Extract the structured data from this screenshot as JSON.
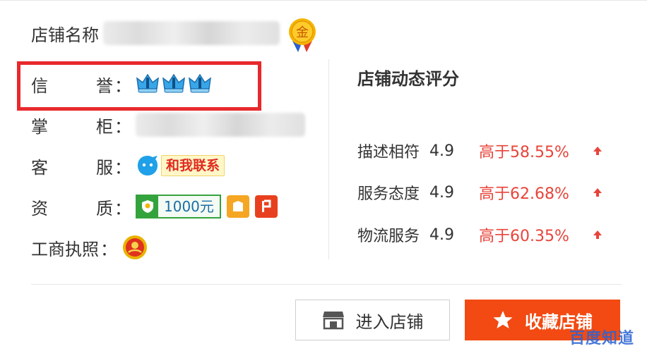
{
  "store": {
    "name_label": "店铺名称",
    "credit_label_1": "信",
    "credit_label_2": "誉",
    "owner_label_1": "掌",
    "owner_label_2": "柜",
    "service_label_1": "客",
    "service_label_2": "服",
    "service_button": "和我联系",
    "qualification_label_1": "资",
    "qualification_label_2": "质",
    "deposit_amount": "1000元",
    "license_label": "工商执照",
    "colon": "：",
    "gold_badge_text": "金",
    "credit_crown_count": 3
  },
  "ratings": {
    "title": "店铺动态评分",
    "items": [
      {
        "name": "描述相符",
        "score": "4.9",
        "compare": "高于58.55%"
      },
      {
        "name": "服务态度",
        "score": "4.9",
        "compare": "高于62.68%"
      },
      {
        "name": "物流服务",
        "score": "4.9",
        "compare": "高于60.35%"
      }
    ]
  },
  "actions": {
    "enter_label": "进入店铺",
    "favorite_label": "收藏店铺"
  },
  "watermark": "百度知道",
  "colors": {
    "accent_red": "#e8292c",
    "compare_red": "#e8443a",
    "favorite_orange": "#f24a12",
    "qualification_green": "#35a33d"
  }
}
